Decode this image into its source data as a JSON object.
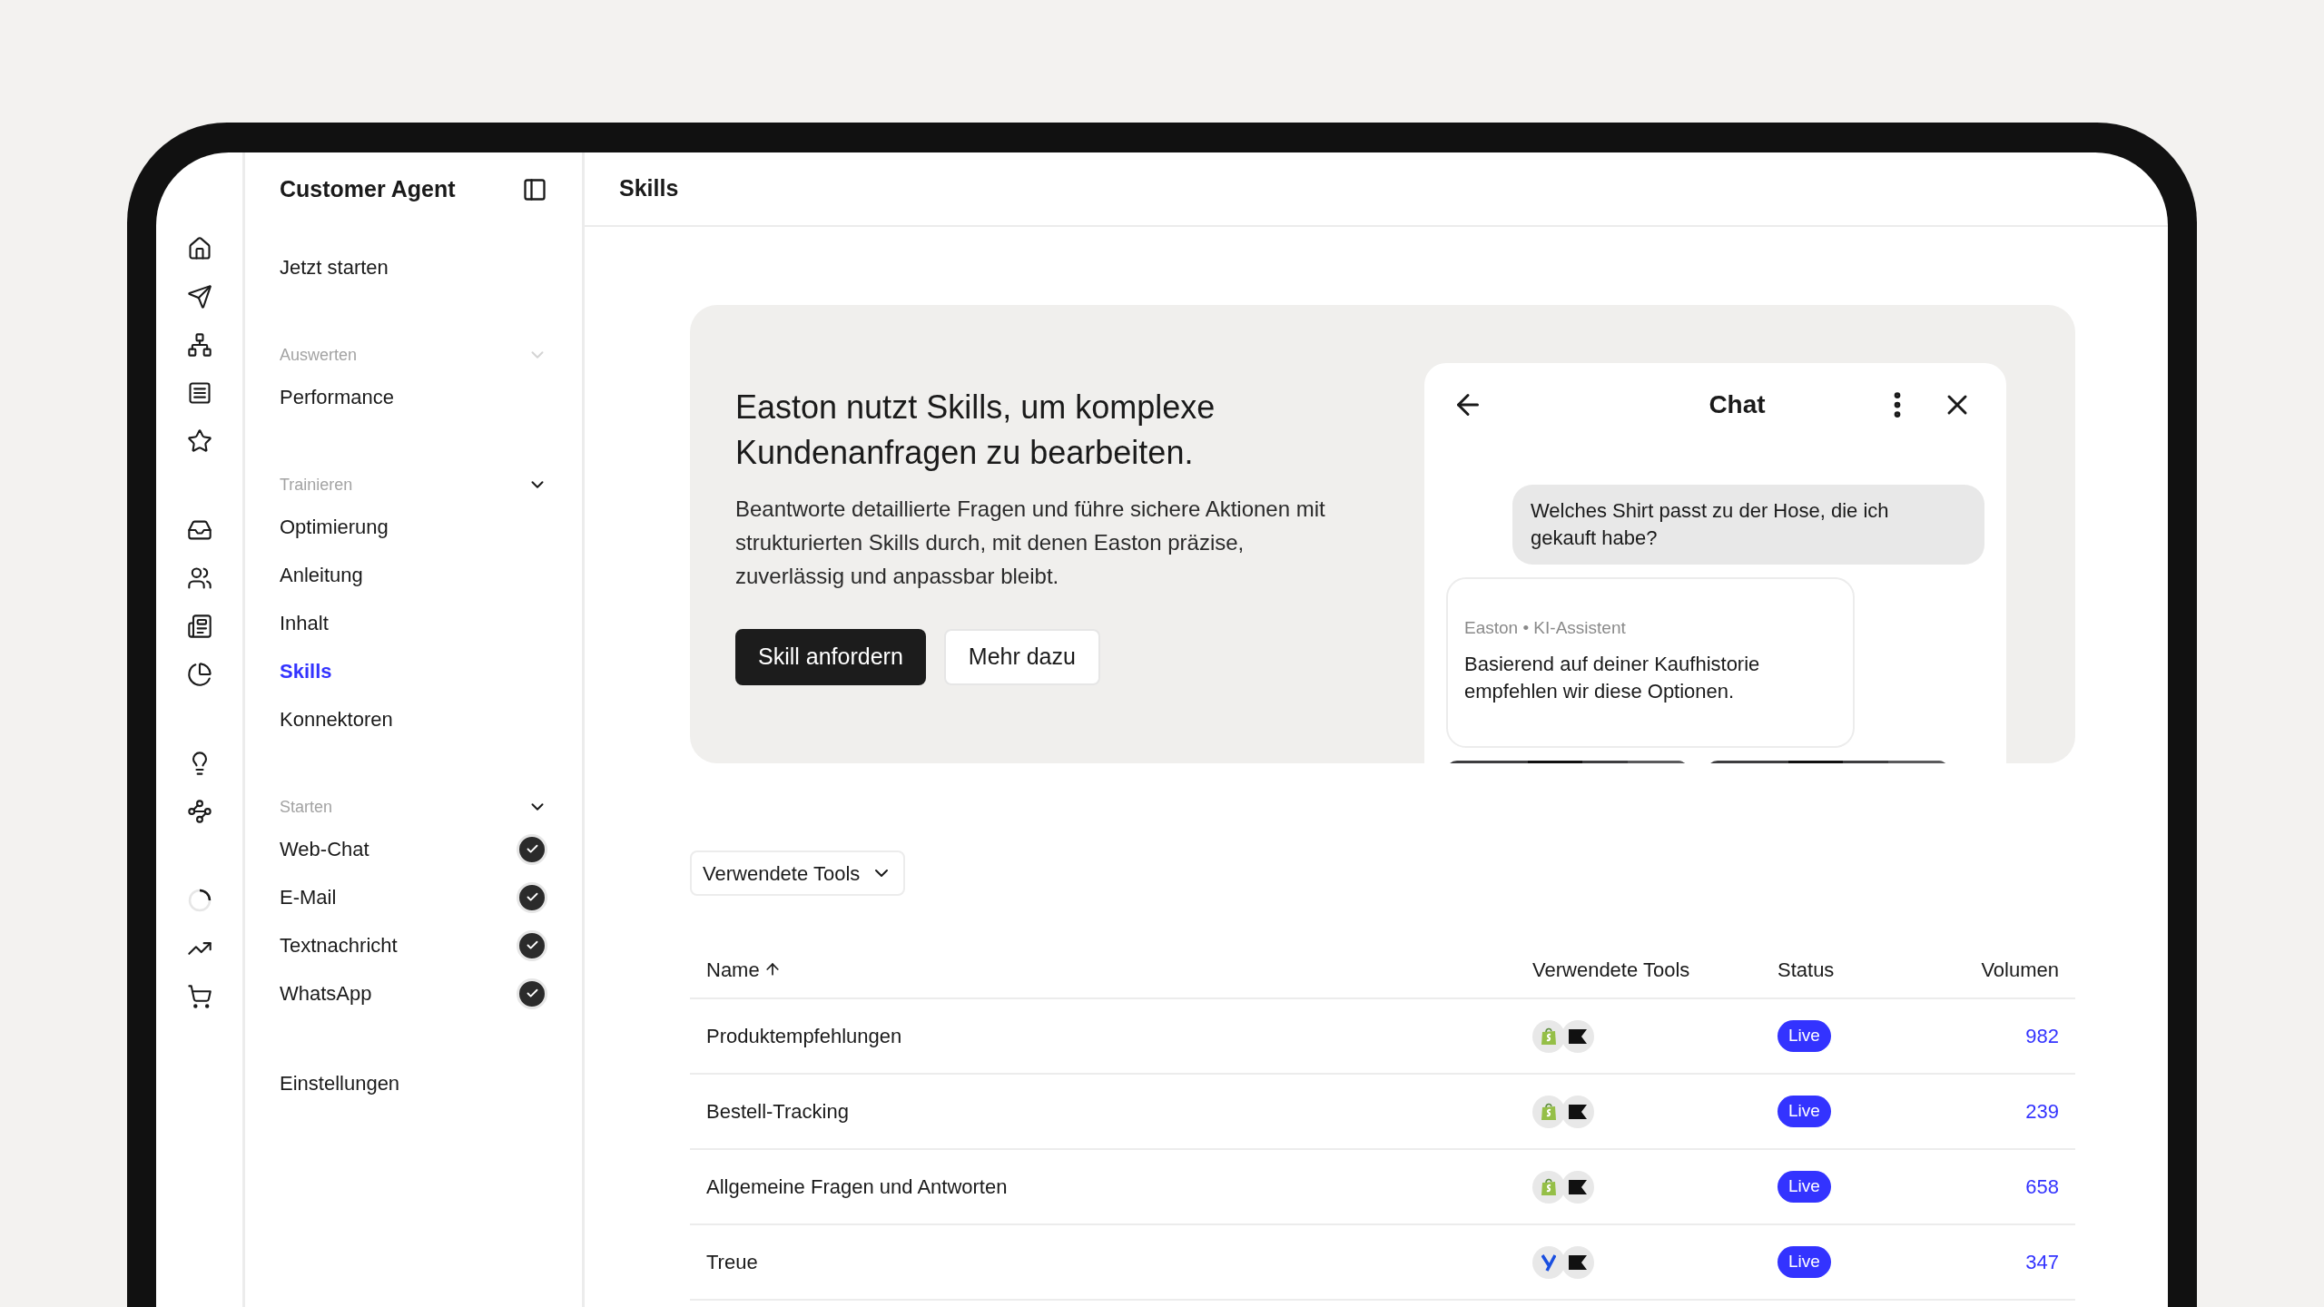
{
  "app": {
    "title": "Customer Agent"
  },
  "nav": {
    "top": [
      {
        "label": "Jetzt starten",
        "selected": false
      }
    ],
    "sections": [
      {
        "title": "Auswerten",
        "expanded": true,
        "items": [
          {
            "label": "Performance",
            "selected": false
          }
        ]
      },
      {
        "title": "Trainieren",
        "expanded": true,
        "items": [
          {
            "label": "Optimierung",
            "selected": false
          },
          {
            "label": "Anleitung",
            "selected": false
          },
          {
            "label": "Inhalt",
            "selected": false
          },
          {
            "label": "Skills",
            "selected": true
          },
          {
            "label": "Konnektoren",
            "selected": false
          }
        ]
      },
      {
        "title": "Starten",
        "expanded": true,
        "items": [
          {
            "label": "Web-Chat",
            "selected": false,
            "checked": true
          },
          {
            "label": "E-Mail",
            "selected": false,
            "checked": true
          },
          {
            "label": "Textnachricht",
            "selected": false,
            "checked": true
          },
          {
            "label": "WhatsApp",
            "selected": false,
            "checked": true
          }
        ]
      }
    ],
    "bottom": [
      {
        "label": "Einstellungen",
        "selected": false
      }
    ]
  },
  "page": {
    "title": "Skills"
  },
  "banner": {
    "heading": "Easton nutzt Skills, um komplexe Kundenanfragen zu bearbeiten.",
    "body": "Beantworte detaillierte Fragen und führe sichere Aktionen mit strukturierten Skills durch, mit denen Easton präzise, zuverlässig und anpassbar bleibt.",
    "buttons": [
      {
        "label": "Skill anfordern",
        "kind": "primary"
      },
      {
        "label": "Mehr dazu",
        "kind": "secondary"
      }
    ],
    "chat": {
      "title": "Chat",
      "messages": [
        {
          "kind": "user",
          "text": "Welches Shirt passt zu der Hose, die ich gekauft habe?"
        },
        {
          "kind": "assistant",
          "sender": "Easton • KI-Assistent",
          "text": "Basierend auf deiner Kaufhistorie empfehlen wir diese Optionen."
        }
      ]
    }
  },
  "filter": {
    "label": "Verwendete Tools"
  },
  "table": {
    "columns": [
      {
        "label": "Name",
        "sorted": true
      },
      {
        "label": "Verwendete Tools"
      },
      {
        "label": "Status"
      },
      {
        "label": "Volumen"
      }
    ],
    "rows": [
      {
        "name": "Produktempfehlungen",
        "tools": [
          {
            "kind": "shopify"
          },
          {
            "kind": "flag"
          }
        ],
        "status": "Live",
        "volume": "982"
      },
      {
        "name": "Bestell-Tracking",
        "tools": [
          {
            "kind": "shopify"
          },
          {
            "kind": "flag"
          }
        ],
        "status": "Live",
        "volume": "239"
      },
      {
        "name": "Allgemeine Fragen und Antworten",
        "tools": [
          {
            "kind": "shopify"
          },
          {
            "kind": "flag"
          }
        ],
        "status": "Live",
        "volume": "658"
      },
      {
        "name": "Treue",
        "tools": [
          {
            "kind": "yotpo"
          },
          {
            "kind": "flag"
          }
        ],
        "status": "Live",
        "volume": "347"
      }
    ]
  }
}
